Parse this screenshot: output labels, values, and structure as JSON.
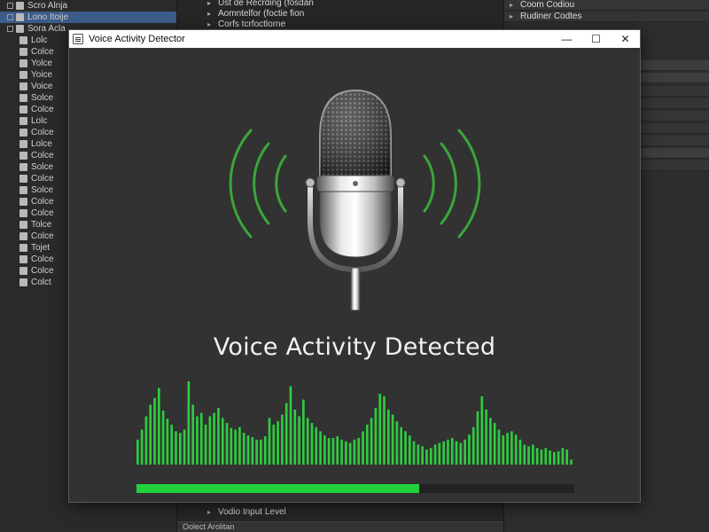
{
  "background": {
    "left_tree": [
      {
        "label": "Scro Alnja",
        "box": true,
        "icon": true
      },
      {
        "label": "Lono Itoije",
        "box": true,
        "icon": true,
        "selected": true
      },
      {
        "label": "Sora Acla",
        "box": true,
        "icon": true
      },
      {
        "label": "Lolc",
        "icon": true
      },
      {
        "label": "Colce",
        "icon": true
      },
      {
        "label": "Yolce",
        "icon": true
      },
      {
        "label": "Yoice",
        "icon": true
      },
      {
        "label": "Voice",
        "icon": true
      },
      {
        "label": "Solce",
        "icon": true
      },
      {
        "label": "Colce",
        "icon": true
      },
      {
        "label": "Lolc",
        "icon": true
      },
      {
        "label": "Colce",
        "icon": true
      },
      {
        "label": "Lolce",
        "icon": true
      },
      {
        "label": "Colce",
        "icon": true
      },
      {
        "label": "Solce",
        "icon": true
      },
      {
        "label": "Colce",
        "icon": true
      },
      {
        "label": "Solce",
        "icon": true
      },
      {
        "label": "Colce",
        "icon": true
      },
      {
        "label": "Colce",
        "icon": true
      },
      {
        "label": "Tolce",
        "icon": true
      },
      {
        "label": "Colce",
        "icon": true
      },
      {
        "label": "Tojet",
        "icon": true
      },
      {
        "label": "Colce",
        "icon": true
      },
      {
        "label": "Colce",
        "icon": true
      },
      {
        "label": "Colct",
        "icon": true
      }
    ],
    "mid_lines": [
      "Ust de Recrding (fosdan",
      "Aomntelfor (foctie fion",
      "Corfs tcrfoctlorne"
    ],
    "mid_bottom_lines": [
      "Vodio Input Level"
    ],
    "mid_footer": "Oolect Arolitan",
    "right_rows": [
      {
        "label": "Coom Codiou",
        "dark": false
      },
      {
        "label": "Rudiner Codtes",
        "dark": false
      },
      {
        "label": "",
        "dark": true
      },
      {
        "label": "",
        "dark": true
      },
      {
        "label": "",
        "dark": false
      },
      {
        "label": "",
        "dark": false
      },
      {
        "label": "",
        "dark": false
      },
      {
        "label": "",
        "dark": false
      },
      {
        "label": "",
        "dark": false
      },
      {
        "label": "",
        "dark": true
      },
      {
        "label": "",
        "dark": false
      }
    ]
  },
  "dialog": {
    "title": "Voice Activity Detector",
    "minimize_symbol": "—",
    "maximize_symbol": "☐",
    "close_symbol": "✕",
    "status_text": "Voice Activity Detected",
    "accent_color": "#22d13a",
    "wave_color": "#2ecc40",
    "signal_color": "#3aa63a",
    "level": 0.645,
    "waveform": [
      0.3,
      0.42,
      0.58,
      0.72,
      0.8,
      0.92,
      0.65,
      0.55,
      0.48,
      0.4,
      0.38,
      0.42,
      1.0,
      0.72,
      0.58,
      0.62,
      0.48,
      0.58,
      0.62,
      0.68,
      0.56,
      0.5,
      0.44,
      0.42,
      0.45,
      0.38,
      0.35,
      0.33,
      0.3,
      0.3,
      0.34,
      0.56,
      0.48,
      0.52,
      0.6,
      0.74,
      0.94,
      0.66,
      0.58,
      0.78,
      0.56,
      0.5,
      0.45,
      0.4,
      0.35,
      0.32,
      0.32,
      0.34,
      0.3,
      0.28,
      0.26,
      0.3,
      0.32,
      0.4,
      0.48,
      0.56,
      0.68,
      0.85,
      0.82,
      0.66,
      0.6,
      0.52,
      0.45,
      0.4,
      0.35,
      0.28,
      0.24,
      0.22,
      0.18,
      0.2,
      0.24,
      0.26,
      0.28,
      0.3,
      0.32,
      0.28,
      0.26,
      0.3,
      0.36,
      0.45,
      0.64,
      0.82,
      0.66,
      0.56,
      0.5,
      0.42,
      0.35,
      0.38,
      0.4,
      0.36,
      0.3,
      0.24,
      0.22,
      0.24,
      0.2,
      0.18,
      0.2,
      0.17,
      0.15,
      0.16,
      0.2,
      0.18,
      0.06
    ]
  }
}
